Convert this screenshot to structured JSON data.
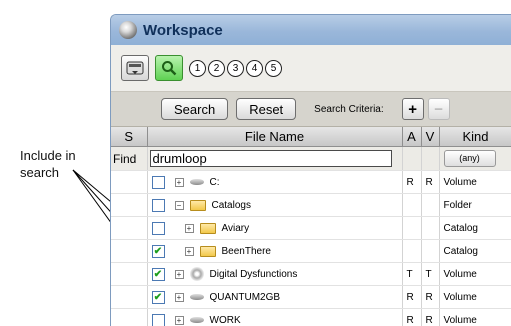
{
  "callout": {
    "line1": "Include in",
    "line2": "search"
  },
  "window": {
    "title": "Workspace"
  },
  "toolbar": {
    "numbers": [
      "1",
      "2",
      "3",
      "4",
      "5"
    ]
  },
  "searchbar": {
    "search_label": "Search",
    "reset_label": "Reset",
    "criteria_label": "Search Criteria:",
    "add_label": "+",
    "remove_label": "−"
  },
  "columns": {
    "s": "S",
    "file_name": "File Name",
    "a": "A",
    "v": "V",
    "kind": "Kind"
  },
  "find": {
    "label": "Find",
    "value": "drumloop",
    "kind": "(any)"
  },
  "rows": [
    {
      "name": "C:",
      "a": "R",
      "v": "R",
      "kind": "Volume",
      "checked": false,
      "expand": "+",
      "icon": "disk-icon",
      "indent": 0
    },
    {
      "name": "Catalogs",
      "a": "",
      "v": "",
      "kind": "Folder",
      "checked": false,
      "expand": "−",
      "icon": "folder-icon",
      "indent": 0
    },
    {
      "name": "Aviary",
      "a": "",
      "v": "",
      "kind": "Catalog",
      "checked": false,
      "expand": "+",
      "icon": "folder-icon",
      "indent": 1
    },
    {
      "name": "BeenThere",
      "a": "",
      "v": "",
      "kind": "Catalog",
      "checked": true,
      "expand": "+",
      "icon": "folder-icon",
      "indent": 1
    },
    {
      "name": "Digital Dysfunctions",
      "a": "T",
      "v": "T",
      "kind": "Volume",
      "checked": true,
      "expand": "+",
      "icon": "cd-icon",
      "indent": 0
    },
    {
      "name": "QUANTUM2GB",
      "a": "R",
      "v": "R",
      "kind": "Volume",
      "checked": true,
      "expand": "+",
      "icon": "disk-icon",
      "indent": 0
    },
    {
      "name": "WORK",
      "a": "R",
      "v": "R",
      "kind": "Volume",
      "checked": false,
      "expand": "+",
      "icon": "disk-icon",
      "indent": 0
    }
  ]
}
